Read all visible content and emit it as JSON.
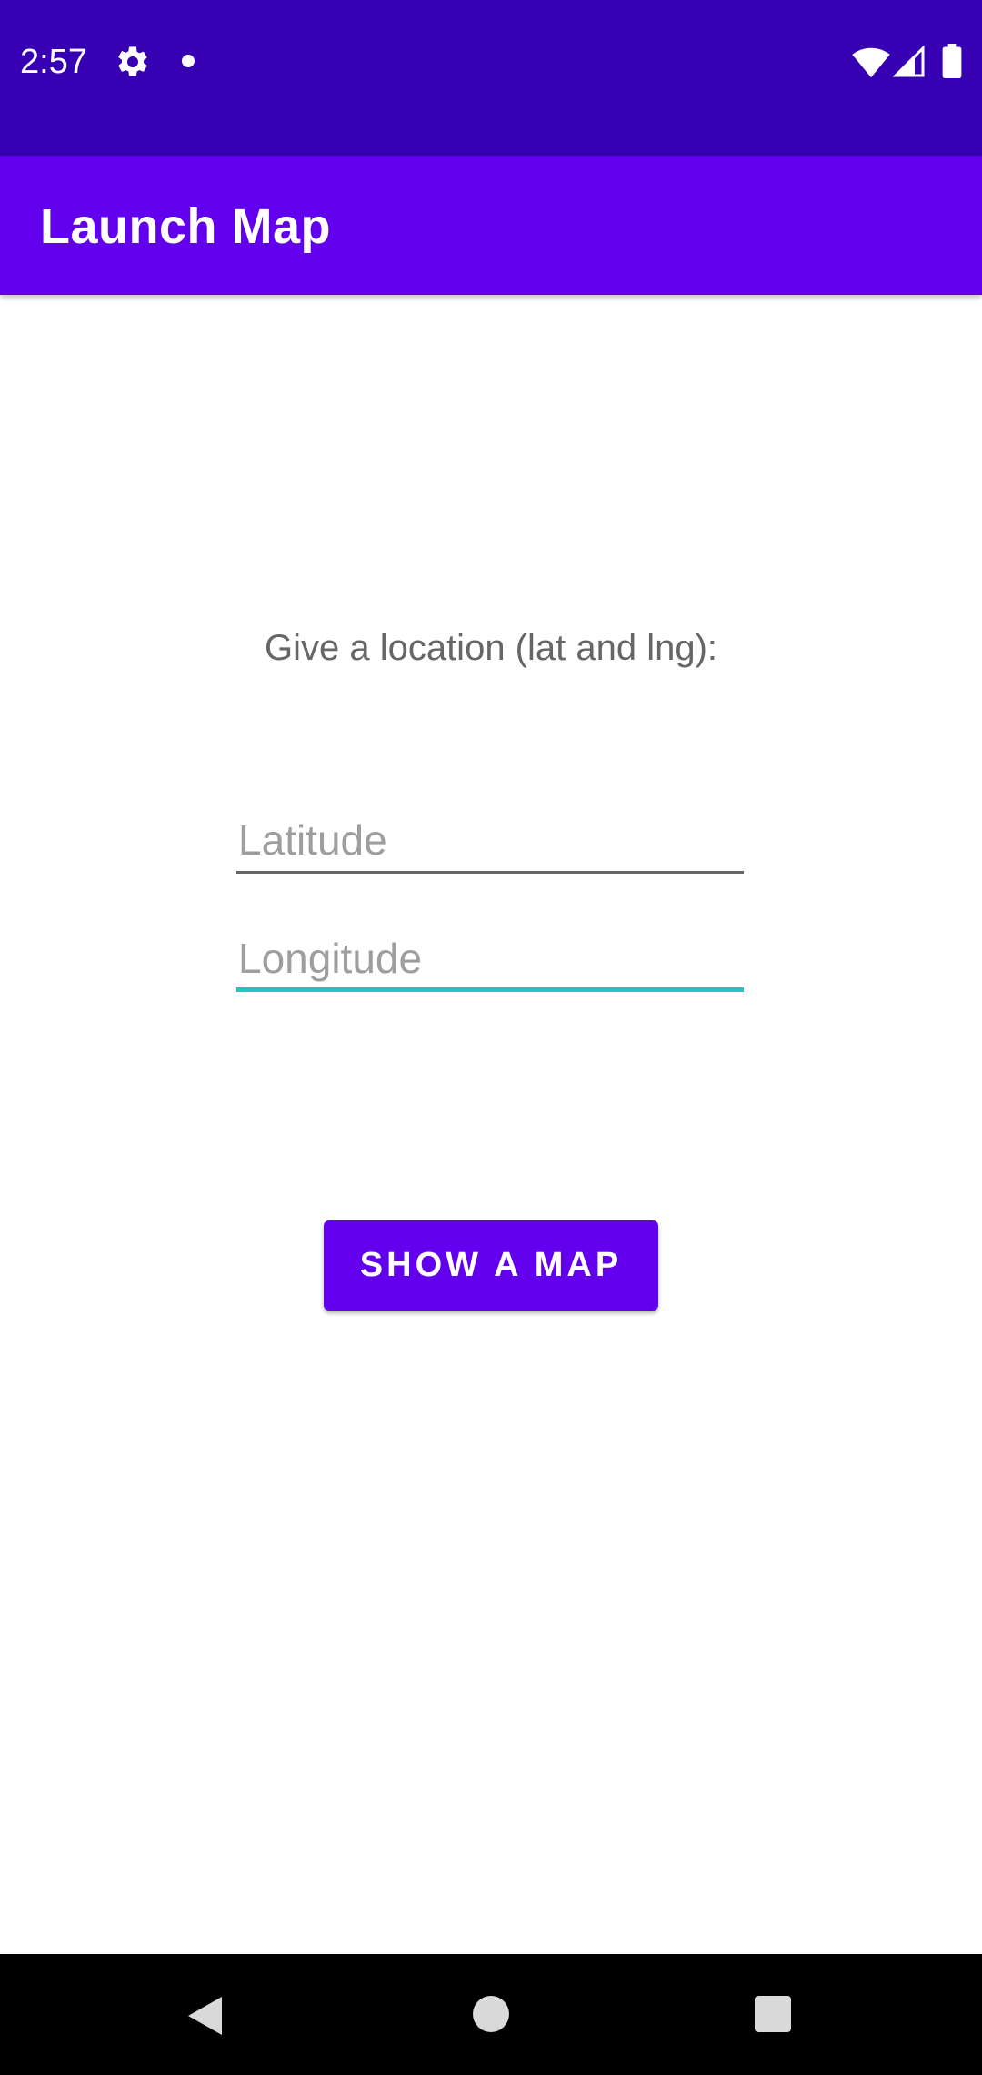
{
  "status_bar": {
    "time": "2:57",
    "icons": [
      "gear-icon",
      "notification-dot-icon",
      "wifi-icon",
      "signal-icon",
      "battery-icon"
    ],
    "background_color": "#3700b3"
  },
  "app_bar": {
    "title": "Launch Map",
    "background_color": "#6200ee"
  },
  "main": {
    "prompt": "Give a location (lat and lng):",
    "latitude": {
      "value": "",
      "placeholder": "Latitude"
    },
    "longitude": {
      "value": "",
      "placeholder": "Longitude",
      "focused": true,
      "accent_color": "#1ec8c1"
    },
    "show_button_label": "SHOW A MAP"
  },
  "nav_bar": {
    "icons": [
      "back-icon",
      "home-icon",
      "recents-icon"
    ]
  }
}
